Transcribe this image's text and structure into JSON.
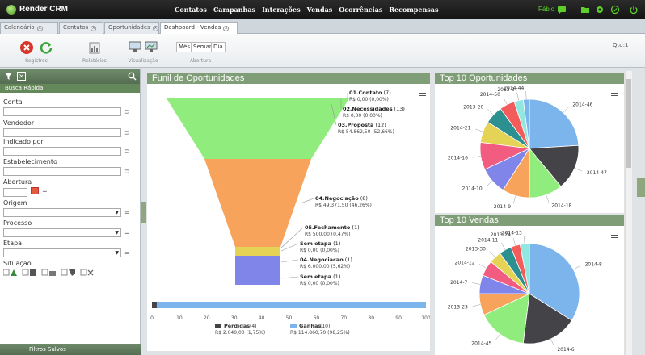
{
  "app": {
    "name": "Render CRM",
    "user": "Fábio"
  },
  "nav": [
    "Contatos",
    "Campanhas",
    "Interações",
    "Vendas",
    "Ocorrências",
    "Recompensas"
  ],
  "tabs": [
    "Calendário",
    "Contatos",
    "Oportunidades",
    "Dashboard - Vendas"
  ],
  "toolbar": {
    "registros": "Registros",
    "relatorios": "Relatórios",
    "visualizacao": "Visualização",
    "periods": [
      "Mês",
      "Semana",
      "Dia"
    ],
    "abertura": "Abertura",
    "qtd": "Qtd:1"
  },
  "sidebar": {
    "busca": "Busca Rápida",
    "fields": [
      "Conta",
      "Vendedor",
      "Indicado por",
      "Estabelecimento",
      "Abertura",
      "Origem",
      "Processo",
      "Etapa",
      "Situação"
    ],
    "footer": "Filtros Salvos"
  },
  "funnel": {
    "title": "Funil de Oportunidades",
    "stages": [
      {
        "name": "01.Contato",
        "count": "(7)",
        "value": "R$ 0,00 (0,00%)",
        "color": "#90ed7d"
      },
      {
        "name": "02.Necessidades",
        "count": "(13)",
        "value": "R$ 0,00 (0,00%)",
        "color": "#90ed7d"
      },
      {
        "name": "03.Proposta",
        "count": "(12)",
        "value": "R$ 54.862,50 (52,66%)",
        "color": "#90ed7d"
      },
      {
        "name": "04.Negociação",
        "count": "(8)",
        "value": "R$ 49.371,50 (46,26%)",
        "color": "#f7a35c"
      },
      {
        "name": "05.Fechamento",
        "count": "(1)",
        "value": "R$ 500,00 (0,47%)",
        "color": "#f7a35c"
      },
      {
        "name": "Sem etapa",
        "count": "(1)",
        "value": "R$ 0,00 (0,00%)",
        "color": "#e4d354"
      },
      {
        "name": "04.Negociacao",
        "count": "(1)",
        "value": "R$ 6.000,00 (5,62%)",
        "color": "#8085e9"
      },
      {
        "name": "Sem etapa",
        "count": "(1)",
        "value": "R$ 0,00 (0,00%)",
        "color": "#8085e9"
      }
    ]
  },
  "progress": {
    "ticks": [
      "0",
      "10",
      "20",
      "30",
      "40",
      "50",
      "60",
      "70",
      "80",
      "90",
      "100"
    ],
    "perdidas_label": "Perdidas",
    "perdidas_count": "(4)",
    "perdidas_value": "R$ 2.040,00 (1,75%)",
    "ganhas_label": "Ganhas",
    "ganhas_count": "(10)",
    "ganhas_value": "R$ 114.860,70 (98,25%)",
    "perdidas_pct": 1.75
  },
  "chart_data": [
    {
      "type": "pie",
      "title": "Top 10 Oportunidades",
      "labels": [
        "2014-46",
        "2014-47",
        "2014-18",
        "2014-9",
        "2014-10",
        "2014-16",
        "2014-21",
        "2013-20",
        "2014-50",
        "2013-3",
        "2014-44"
      ],
      "values": [
        24,
        15,
        11,
        9,
        9,
        9,
        7,
        6,
        5,
        3,
        2
      ],
      "colors": [
        "#7cb5ec",
        "#434348",
        "#90ed7d",
        "#f7a35c",
        "#8085e9",
        "#f15c80",
        "#e4d354",
        "#2b908f",
        "#f45b5b",
        "#91e8e1",
        "#7cb5ec"
      ]
    },
    {
      "type": "pie",
      "title": "Top 10 Vendas",
      "labels": [
        "2014-8",
        "2014-6",
        "2014-45",
        "2013-23",
        "2014-7",
        "2014-12",
        "2013-30",
        "2014-11",
        "2013-24",
        "2014-13"
      ],
      "values": [
        34,
        18,
        16,
        7,
        6,
        5,
        4,
        4,
        3,
        3
      ],
      "colors": [
        "#7cb5ec",
        "#434348",
        "#90ed7d",
        "#f7a35c",
        "#8085e9",
        "#f15c80",
        "#e4d354",
        "#2b908f",
        "#f45b5b",
        "#91e8e1"
      ]
    }
  ]
}
